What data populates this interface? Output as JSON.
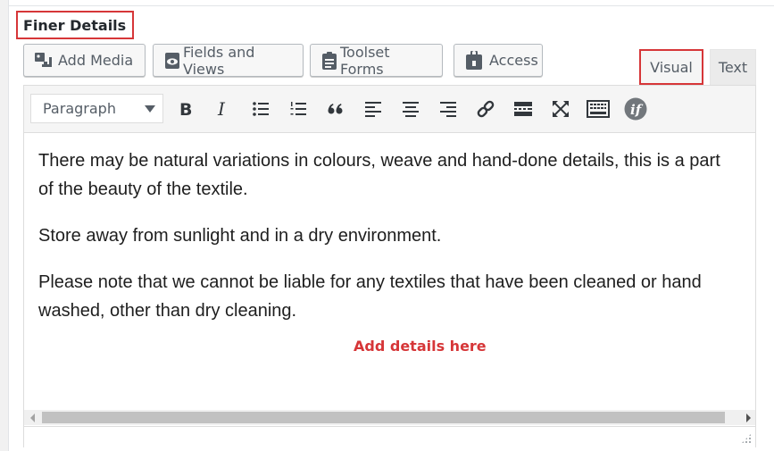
{
  "metabox": {
    "title": "Finer Details"
  },
  "media_buttons": [
    {
      "label": "Add Media",
      "icon": "add-media-icon"
    },
    {
      "label": "Fields and Views",
      "icon": "eye-icon"
    },
    {
      "label": "Toolset Forms",
      "icon": "forms-icon"
    },
    {
      "label": "Access",
      "icon": "lock-icon"
    }
  ],
  "tabs": {
    "visual": "Visual",
    "text": "Text"
  },
  "toolbar": {
    "format_value": "Paragraph",
    "buttons": [
      "bold-icon",
      "italic-icon",
      "bulleted-list-icon",
      "numbered-list-icon",
      "blockquote-icon",
      "align-left-icon",
      "align-center-icon",
      "align-right-icon",
      "link-icon",
      "read-more-icon",
      "fullscreen-icon",
      "keyboard-icon",
      "conditional-if-icon"
    ]
  },
  "content": {
    "p1_line1": "There may be natural variations in colours, weave and hand-done details, this is a part",
    "p1_line2": "of the beauty of the textile.",
    "p2": "Store away from sunlight and in a dry environment.",
    "p3_line1": "Please note that we cannot be liable for any textiles that have been cleaned or hand",
    "p3_line2": "washed, other than dry cleaning."
  },
  "annotation": "Add details here",
  "colors": {
    "highlight": "#d63638",
    "toolbar_bg": "#f5f5f5",
    "icon": "#32373c"
  }
}
